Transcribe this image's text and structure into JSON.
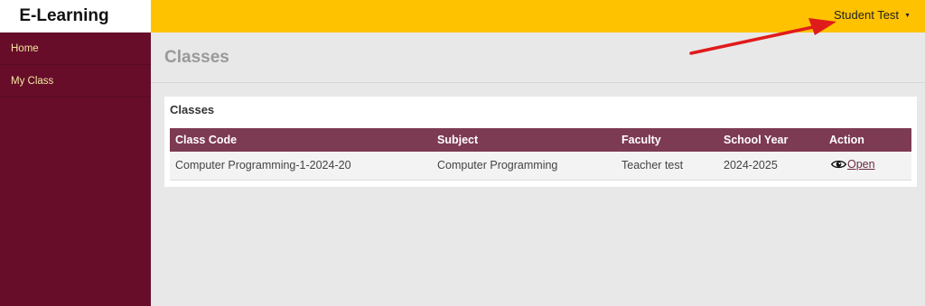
{
  "brand": "E-Learning",
  "sidebar": {
    "items": [
      {
        "label": "Home"
      },
      {
        "label": "My Class"
      }
    ]
  },
  "topbar": {
    "user_label": "Student Test",
    "caret_icon": "caret-down-icon"
  },
  "page": {
    "title": "Classes"
  },
  "card": {
    "title": "Classes",
    "columns": [
      "Class Code",
      "Subject",
      "Faculty",
      "School Year",
      "Action"
    ],
    "rows": [
      {
        "class_code": "Computer Programming-1-2024-20",
        "subject": "Computer Programming",
        "faculty": "Teacher test",
        "school_year": "2024-2025",
        "action_label": "Open",
        "action_icon": "eye-icon"
      }
    ]
  },
  "colors": {
    "sidebar": "#670d2a",
    "topbar": "#fec200",
    "table_header": "#7d3a53",
    "annotation_arrow": "#e01b1b"
  }
}
